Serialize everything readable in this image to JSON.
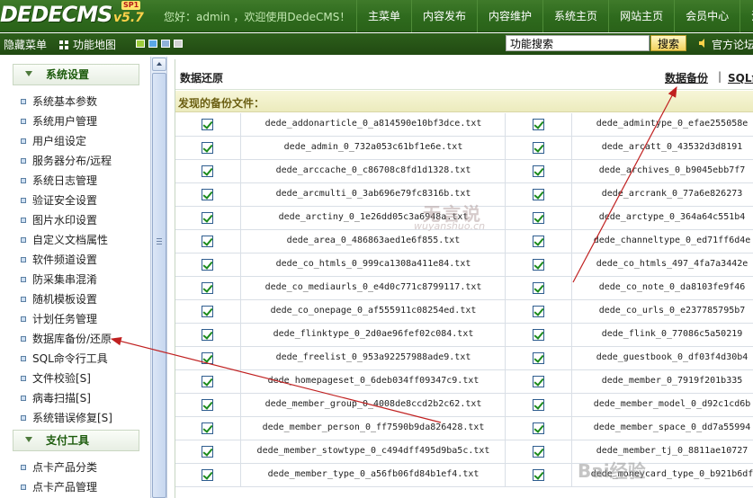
{
  "header": {
    "logo_text": "DEDECMS",
    "logo_version": "v5.7",
    "logo_sp": "SP1",
    "welcome": "您好：admin ，欢迎使用DedeCMS！",
    "nav": [
      "主菜单",
      "内容发布",
      "内容维护",
      "系统主页",
      "网站主页",
      "会员中心",
      "注销"
    ]
  },
  "toolbar": {
    "toggle_menu": "隐藏菜单",
    "function_map": "功能地图",
    "skin_colors": [
      "#9ccc3c",
      "#5aa7e6",
      "#8fb1d8",
      "#d2d2d2"
    ],
    "search_value": "功能搜索",
    "search_button": "搜索",
    "forum_link": "官方论坛"
  },
  "sidebar": {
    "groups": [
      {
        "title": "系统设置",
        "items": [
          "系统基本参数",
          "系统用户管理",
          "用户组设定",
          "服务器分布/远程",
          "系统日志管理",
          "验证安全设置",
          "图片水印设置",
          "自定义文档属性",
          "软件频道设置",
          "防采集串混淆",
          "随机模板设置",
          "计划任务管理",
          "数据库备份/还原",
          "SQL命令行工具",
          "文件校验[S]",
          "病毒扫描[S]",
          "系统错误修复[S]"
        ]
      },
      {
        "title": "支付工具",
        "items": [
          "点卡产品分类",
          "点卡产品管理"
        ]
      }
    ]
  },
  "main": {
    "title": "数据还原",
    "backup_link": "数据备份",
    "separator": "|",
    "sql_link": "SQL命",
    "section_label": "发现的备份文件：",
    "files": [
      [
        "dede_addonarticle_0_a814590e10bf3dce.txt",
        "dede_admintype_0_efae255058e"
      ],
      [
        "dede_admin_0_732a053c61bf1e6e.txt",
        "dede_arcatt_0_43532d3d8191"
      ],
      [
        "dede_arccache_0_c86708c8fd1d1328.txt",
        "dede_archives_0_b9045ebb7f7"
      ],
      [
        "dede_arcmulti_0_3ab696e79fc8316b.txt",
        "dede_arcrank_0_77a6e826273"
      ],
      [
        "dede_arctiny_0_1e26dd05c3a6948a.txt",
        "dede_arctype_0_364a64c551b4"
      ],
      [
        "dede_area_0_486863aed1e6f855.txt",
        "dede_channeltype_0_ed71ff6d4e"
      ],
      [
        "dede_co_htmls_0_999ca1308a411e84.txt",
        "dede_co_htmls_497_4fa7a3442e"
      ],
      [
        "dede_co_mediaurls_0_e4d0c771c8799117.txt",
        "dede_co_note_0_da8103fe9f46"
      ],
      [
        "dede_co_onepage_0_af555911c08254ed.txt",
        "dede_co_urls_0_e237785795b7"
      ],
      [
        "dede_flinktype_0_2d0ae96fef02c084.txt",
        "dede_flink_0_77086c5a50219"
      ],
      [
        "dede_freelist_0_953a92257988ade9.txt",
        "dede_guestbook_0_df03f4d30b4"
      ],
      [
        "dede_homepageset_0_6deb034ff09347c9.txt",
        "dede_member_0_7919f201b335"
      ],
      [
        "dede_member_group_0_4008de8ccd2b2c62.txt",
        "dede_member_model_0_d92c1cd6b"
      ],
      [
        "dede_member_person_0_ff7590b9da826428.txt",
        "dede_member_space_0_dd7a55994"
      ],
      [
        "dede_member_stowtype_0_c494dff495d9ba5c.txt",
        "dede_member_tj_0_8811ae10727"
      ],
      [
        "dede_member_type_0_a56fb06fd84b1ef4.txt",
        "dede_moneycard_type_0_b921b6df"
      ]
    ]
  },
  "watermarks": {
    "cn": "无言说",
    "url": "wuyanshuo.cn",
    "baidu": "Bai经验"
  }
}
